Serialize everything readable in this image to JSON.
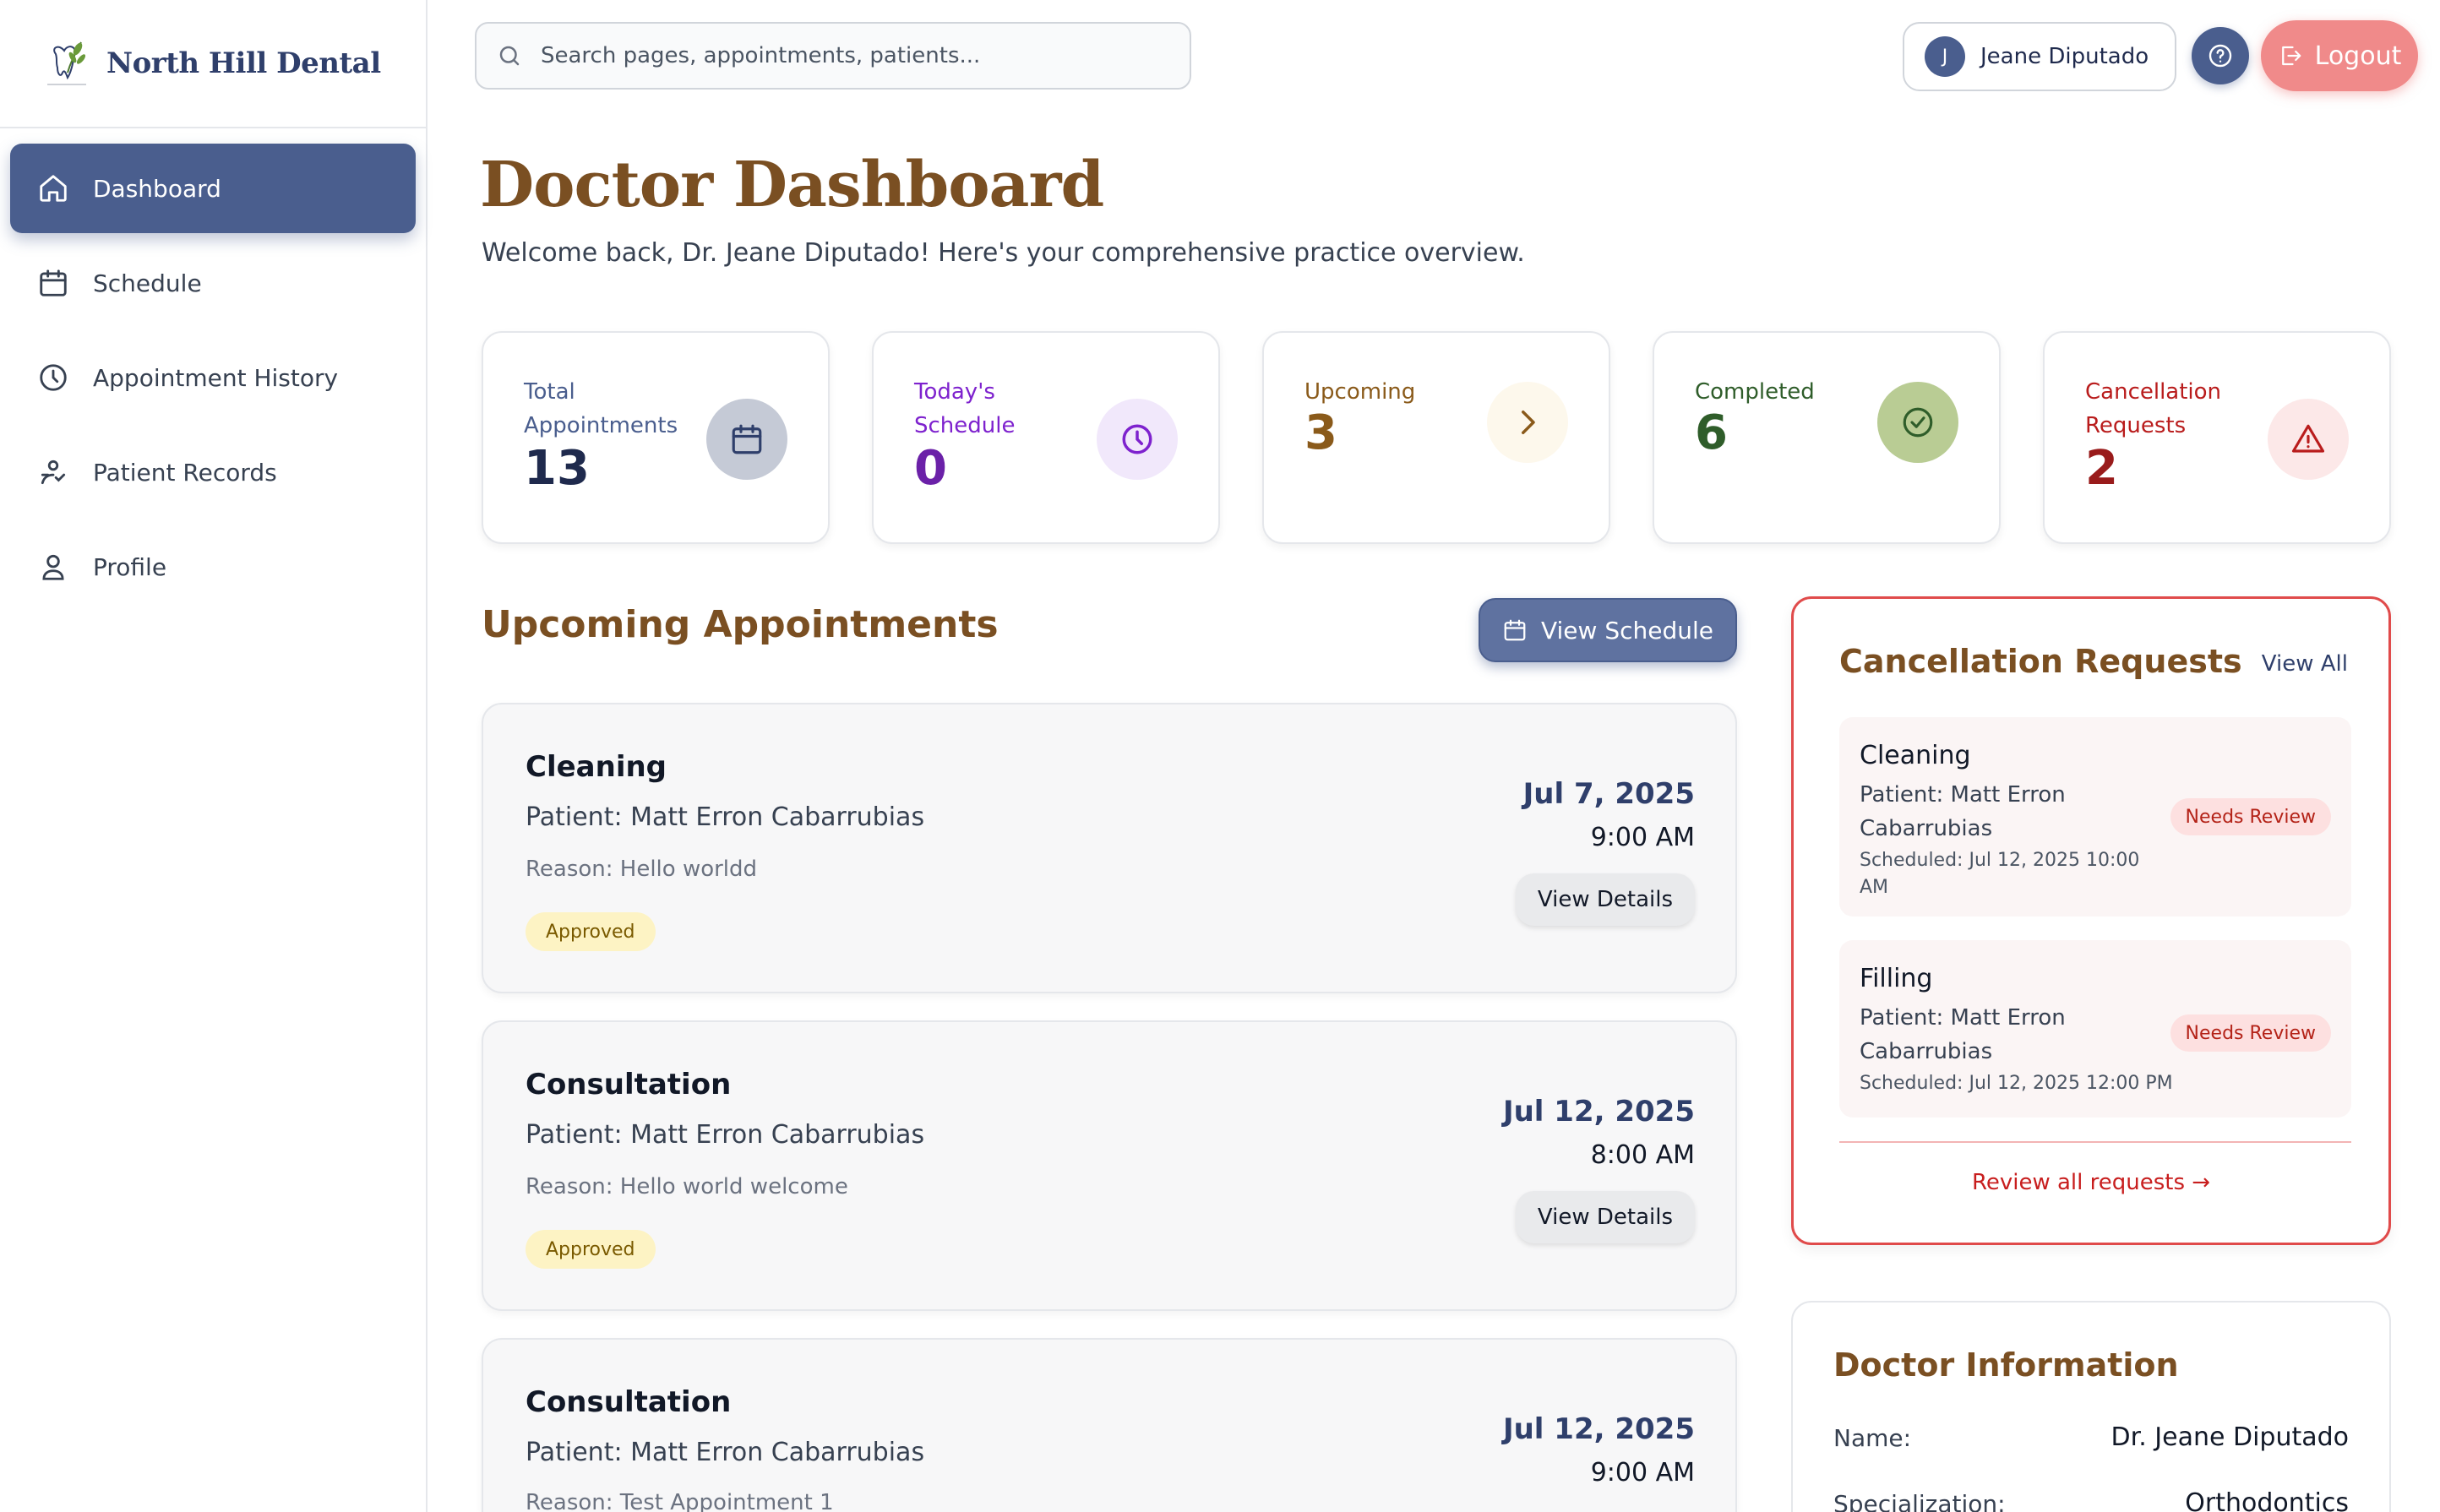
{
  "brand": {
    "name": "North Hill Dental"
  },
  "sidebar": {
    "items": [
      {
        "label": "Dashboard"
      },
      {
        "label": "Schedule"
      },
      {
        "label": "Appointment History"
      },
      {
        "label": "Patient Records"
      },
      {
        "label": "Profile"
      }
    ]
  },
  "header": {
    "search_placeholder": "Search pages, appointments, patients...",
    "user_initial": "J",
    "user_name": "Jeane Diputado",
    "logout_label": "Logout"
  },
  "page": {
    "title": "Doctor Dashboard",
    "subtitle": "Welcome back, Dr. Jeane Diputado! Here's your comprehensive practice overview."
  },
  "stats": [
    {
      "label": "Total Appointments",
      "value": "13",
      "color": "#1f2a4d",
      "icon": "calendar-icon"
    },
    {
      "label": "Today's Schedule",
      "value": "0",
      "color": "#6b21a8",
      "icon": "clock-icon"
    },
    {
      "label": "Upcoming",
      "value": "3",
      "color": "#8a5a1a",
      "icon": "chevron-right-icon"
    },
    {
      "label": "Completed",
      "value": "6",
      "color": "#2f5d2a",
      "icon": "check-circle-icon"
    },
    {
      "label": "Cancellation Requests",
      "value": "2",
      "color": "#991b1b",
      "icon": "warning-icon"
    }
  ],
  "upcoming": {
    "title": "Upcoming Appointments",
    "view_schedule_label": "View Schedule",
    "appointments": [
      {
        "type": "Cleaning",
        "patient": "Patient: Matt Erron Cabarrubias",
        "reason": "Reason: Hello worldd",
        "status": "Approved",
        "date": "Jul 7, 2025",
        "time": "9:00 AM",
        "action": "View Details"
      },
      {
        "type": "Consultation",
        "patient": "Patient: Matt Erron Cabarrubias",
        "reason": "Reason: Hello world welcome",
        "status": "Approved",
        "date": "Jul 12, 2025",
        "time": "8:00 AM",
        "action": "View Details"
      },
      {
        "type": "Consultation",
        "patient": "Patient: Matt Erron Cabarrubias",
        "reason": "Reason: Test Appointment 1",
        "status": "",
        "date": "Jul 12, 2025",
        "time": "9:00 AM",
        "action": ""
      }
    ]
  },
  "cancellations": {
    "title": "Cancellation Requests",
    "view_all_label": "View All",
    "requests": [
      {
        "type": "Cleaning",
        "patient": "Patient: Matt Erron Cabarrubias",
        "scheduled": "Scheduled: Jul 12, 2025 10:00 AM",
        "badge": "Needs Review"
      },
      {
        "type": "Filling",
        "patient": "Patient: Matt Erron Cabarrubias",
        "scheduled": "Scheduled: Jul 12, 2025 12:00 PM",
        "badge": "Needs Review"
      }
    ],
    "review_all_label": "Review all requests →"
  },
  "doctor": {
    "title": "Doctor Information",
    "name_label": "Name:",
    "name_value": "Dr. Jeane Diputado",
    "spec_label": "Specialization:",
    "spec_value": "Orthodontics"
  }
}
